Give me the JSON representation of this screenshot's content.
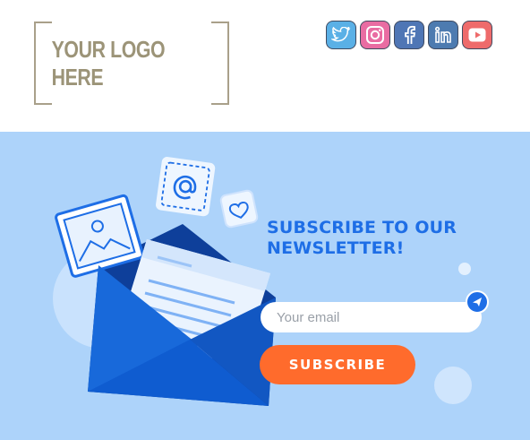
{
  "header": {
    "logo_text": "YOUR LOGO HERE",
    "social_icons": [
      "twitter-icon",
      "instagram-icon",
      "facebook-icon",
      "linkedin-icon",
      "youtube-icon"
    ]
  },
  "newsletter": {
    "headline_line1": "SUBSCRIBE TO OUR",
    "headline_line2": "NEWSLETTER!",
    "email_placeholder": "Your email",
    "button_label": "SUBSCRIBE"
  },
  "colors": {
    "hero_background": "#add3fa",
    "accent_blue": "#1e6ee6",
    "button_orange": "#ff6b2c",
    "logo_text": "#9c9478"
  }
}
